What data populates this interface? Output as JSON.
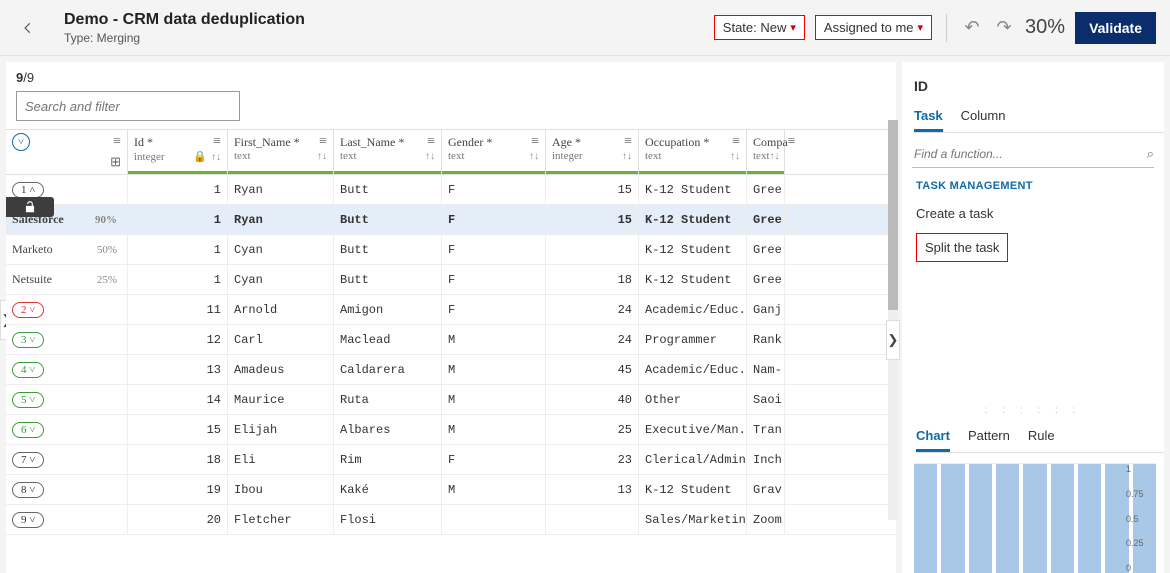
{
  "header": {
    "title": "Demo - CRM data deduplication",
    "subtitle": "Type: Merging",
    "state_label": "State: New",
    "assigned_label": "Assigned to me",
    "percent": "30%",
    "validate": "Validate"
  },
  "counter_current": "9",
  "counter_total": "/9",
  "search_placeholder": "Search and filter",
  "columns": [
    {
      "label": "Id *",
      "type": "integer",
      "width": "c1",
      "locked": true
    },
    {
      "label": "First_Name *",
      "type": "text",
      "width": "c2"
    },
    {
      "label": "Last_Name *",
      "type": "text",
      "width": "c3"
    },
    {
      "label": "Gender *",
      "type": "text",
      "width": "c4"
    },
    {
      "label": "Age *",
      "type": "integer",
      "width": "c5"
    },
    {
      "label": "Occupation *",
      "type": "text",
      "width": "c6"
    },
    {
      "label": "Compa",
      "type": "text",
      "width": "c7"
    }
  ],
  "rows": [
    {
      "kind": "group",
      "pill": "1 ˄",
      "pill_style": "",
      "id": "1",
      "first": "Ryan",
      "last": "Butt",
      "gender": "F",
      "age": "15",
      "occ": "K-12 Student",
      "comp": "Gree"
    },
    {
      "kind": "src",
      "src": "Salesforce",
      "pct": "90%",
      "id": "1",
      "first": "Ryan",
      "last": "Butt",
      "gender": "F",
      "age": "15",
      "occ": "K-12 Student",
      "comp": "Gree",
      "blue": true
    },
    {
      "kind": "src",
      "src": "Marketo",
      "pct": "50%",
      "id": "1",
      "first": "Cyan",
      "last": "Butt",
      "gender": "F",
      "age": "",
      "occ": "K-12 Student",
      "comp": "Gree"
    },
    {
      "kind": "src",
      "src": "Netsuite",
      "pct": "25%",
      "id": "1",
      "first": "Cyan",
      "last": "Butt",
      "gender": "F",
      "age": "18",
      "occ": "K-12 Student",
      "comp": "Gree"
    },
    {
      "kind": "group",
      "pill": "2 ˅",
      "pill_style": "red",
      "id": "11",
      "first": "Arnold",
      "last": "Amigon",
      "gender": "F",
      "age": "24",
      "occ": "Academic/Educ...",
      "comp": "Ganj"
    },
    {
      "kind": "group",
      "pill": "3 ˅",
      "pill_style": "green",
      "id": "12",
      "first": "Carl",
      "last": "Maclead",
      "gender": "M",
      "age": "24",
      "occ": "Programmer",
      "comp": "Rank"
    },
    {
      "kind": "group",
      "pill": "4 ˅",
      "pill_style": "green",
      "id": "13",
      "first": "Amadeus",
      "last": "Caldarera",
      "gender": "M",
      "age": "45",
      "occ": "Academic/Educ...",
      "comp": "Nam-"
    },
    {
      "kind": "group",
      "pill": "5 ˅",
      "pill_style": "green",
      "id": "14",
      "first": "Maurice",
      "last": "Ruta",
      "gender": "M",
      "age": "40",
      "occ": "Other",
      "comp": "Saoi"
    },
    {
      "kind": "group",
      "pill": "6 ˅",
      "pill_style": "green",
      "id": "15",
      "first": "Elijah",
      "last": "Albares",
      "gender": "M",
      "age": "25",
      "occ": "Executive/Man...",
      "comp": "Tran"
    },
    {
      "kind": "group",
      "pill": "7 ˅",
      "pill_style": "",
      "id": "18",
      "first": "Eli",
      "last": "Rim",
      "gender": "F",
      "age": "23",
      "occ": "Clerical/Admin",
      "comp": "Inch"
    },
    {
      "kind": "group",
      "pill": "8 ˅",
      "pill_style": "",
      "id": "19",
      "first": "Ibou",
      "last": "Kaké",
      "gender": "M",
      "age": "13",
      "occ": "K-12 Student",
      "comp": "Grav"
    },
    {
      "kind": "group",
      "pill": "9 ˅",
      "pill_style": "",
      "id": "20",
      "first": "Fletcher",
      "last": "Flosi",
      "gender": "",
      "age": "",
      "occ": "Sales/Marketing",
      "comp": "Zoom"
    }
  ],
  "right": {
    "title": "ID",
    "tabs": [
      "Task",
      "Column"
    ],
    "active_tab": 0,
    "find_placeholder": "Find a function...",
    "section": "TASK MANAGEMENT",
    "items": [
      "Create a task",
      "Split the task"
    ],
    "highlight_index": 1,
    "lower_tabs": [
      "Chart",
      "Pattern",
      "Rule"
    ],
    "lower_active": 0
  },
  "chart_data": {
    "type": "bar",
    "categories": [
      "b1",
      "b2",
      "b3",
      "b4",
      "b5",
      "b6",
      "b7",
      "b8",
      "b9"
    ],
    "values": [
      1,
      1,
      1,
      1,
      1,
      1,
      1,
      1,
      1
    ],
    "ylim": [
      0,
      1
    ],
    "yticks": [
      "1",
      "0.75",
      "0.5",
      "0.25",
      "0"
    ]
  }
}
